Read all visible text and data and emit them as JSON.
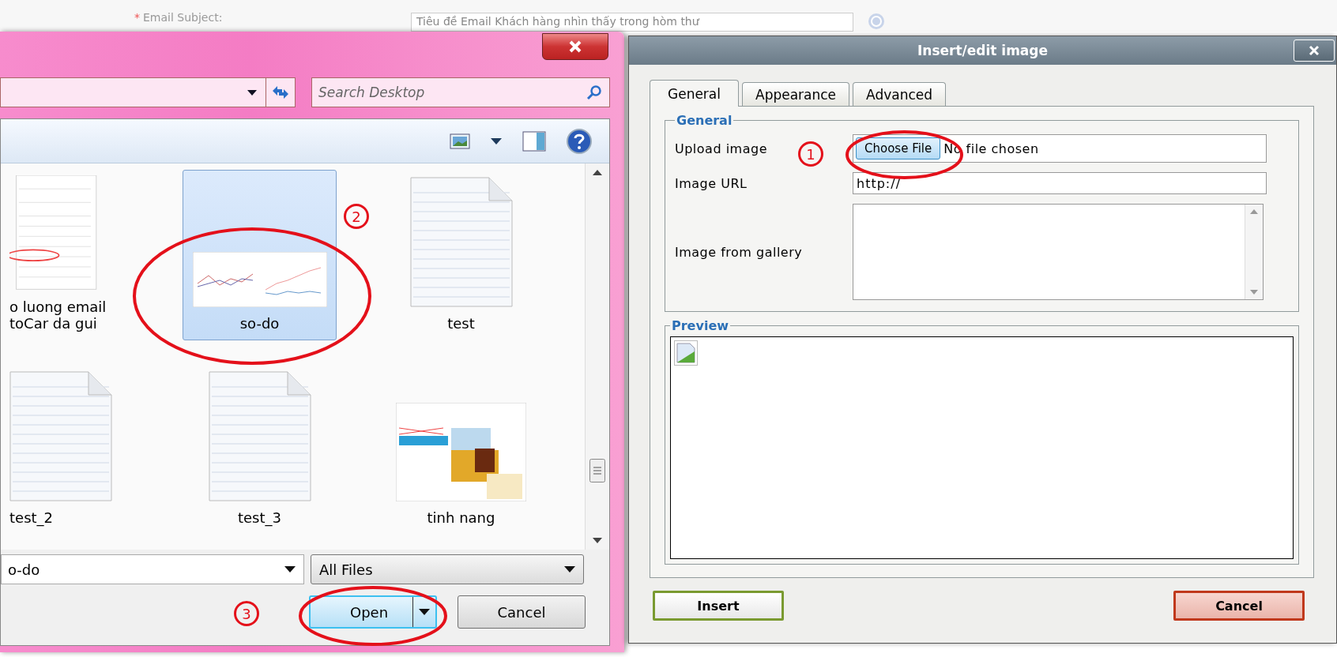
{
  "background_form": {
    "required_mark": "*",
    "field_label": "Email Subject:",
    "field_value": "Tiêu đề Email Khách hàng nhìn thấy trong hòm thư"
  },
  "file_dialog": {
    "search": {
      "placeholder": "Search Desktop"
    },
    "files": [
      {
        "name": "o luong email\ntoCar da gui",
        "kind": "screenshot",
        "selected": false
      },
      {
        "name": "so-do",
        "kind": "chart",
        "selected": true
      },
      {
        "name": "test",
        "kind": "document",
        "selected": false
      },
      {
        "name": "test_2",
        "kind": "document",
        "selected": false
      },
      {
        "name": "test_3",
        "kind": "document",
        "selected": false
      },
      {
        "name": "tinh nang",
        "kind": "webpage",
        "selected": false
      }
    ],
    "file_name": "o-do",
    "file_type": "All Files",
    "buttons": [
      {
        "label": "Open",
        "kind": "split"
      },
      {
        "label": "Cancel",
        "kind": "plain"
      }
    ]
  },
  "image_dialog": {
    "title": "Insert/edit image",
    "tabs": [
      {
        "label": "General",
        "selected": true
      },
      {
        "label": "Appearance",
        "selected": false
      },
      {
        "label": "Advanced",
        "selected": false
      }
    ],
    "general_legend": "General",
    "upload_label": "Upload image",
    "choose_file": "Choose File",
    "file_status": "No file chosen",
    "url_label": "Image URL",
    "url_value": "http://",
    "gallery_label": "Image from gallery",
    "preview_legend": "Preview",
    "buttons": [
      {
        "label": "Insert",
        "kind": "confirm"
      },
      {
        "label": "Cancel",
        "kind": "cancel"
      }
    ]
  },
  "annotations": [
    {
      "number": "1"
    },
    {
      "number": "2"
    },
    {
      "number": "3"
    }
  ]
}
